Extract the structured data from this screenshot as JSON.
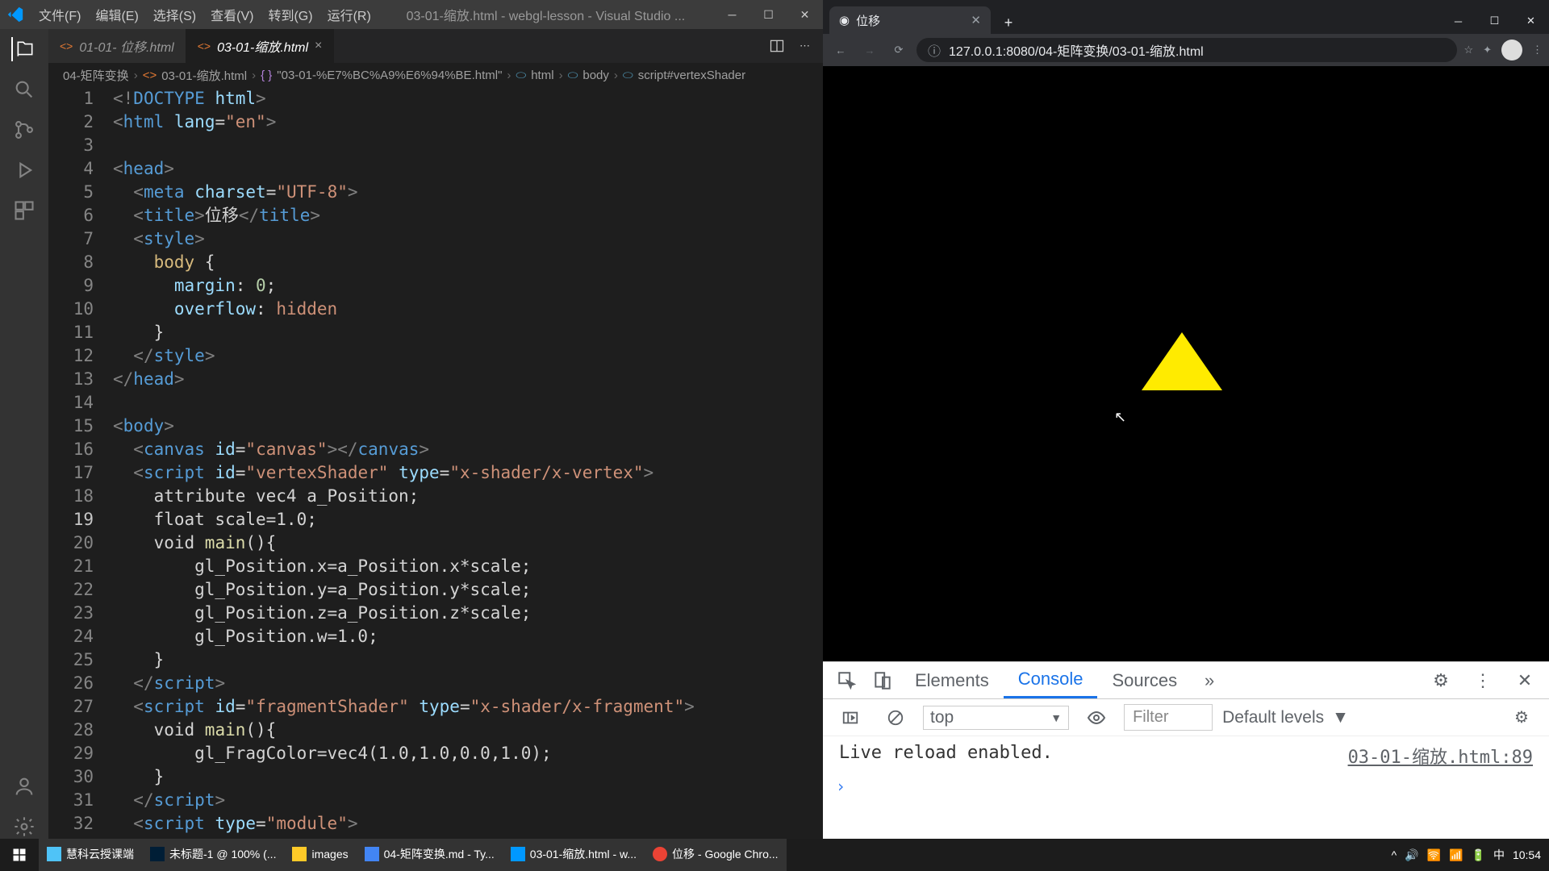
{
  "vscode": {
    "menus": [
      "文件(F)",
      "编辑(E)",
      "选择(S)",
      "查看(V)",
      "转到(G)",
      "运行(R)"
    ],
    "window_title": "03-01-缩放.html - webgl-lesson - Visual Studio ...",
    "tabs": [
      {
        "label": "01-01- 位移.html",
        "active": false
      },
      {
        "label": "03-01-缩放.html",
        "active": true
      }
    ],
    "breadcrumb": [
      "04-矩阵变换",
      "03-01-缩放.html",
      "{}",
      "\"03-01-%E7%BC%A9%E6%94%BE.html\"",
      "html",
      "body",
      "script#vertexShader"
    ],
    "code": {
      "lines": 32,
      "current_line": 19,
      "content_html": "<span class=\"c-pun\">&lt;!</span><span class=\"doctype\">DOCTYPE</span> <span class=\"c-attr\">html</span><span class=\"c-pun\">&gt;</span>\n<span class=\"c-pun\">&lt;</span><span class=\"c-tag\">html</span> <span class=\"c-attr\">lang</span>=<span class=\"c-str\">\"en\"</span><span class=\"c-pun\">&gt;</span>\n\n<span class=\"c-pun\">&lt;</span><span class=\"c-tag\">head</span><span class=\"c-pun\">&gt;</span>\n  <span class=\"c-pun\">&lt;</span><span class=\"c-tag\">meta</span> <span class=\"c-attr\">charset</span>=<span class=\"c-str\">\"UTF-8\"</span><span class=\"c-pun\">&gt;</span>\n  <span class=\"c-pun\">&lt;</span><span class=\"c-tag\">title</span><span class=\"c-pun\">&gt;</span>位移<span class=\"c-pun\">&lt;/</span><span class=\"c-tag\">title</span><span class=\"c-pun\">&gt;</span>\n  <span class=\"c-pun\">&lt;</span><span class=\"c-tag\">style</span><span class=\"c-pun\">&gt;</span>\n    <span class=\"c-sel\">body</span> {\n      <span class=\"c-prop\">margin</span>: <span class=\"c-num\">0</span>;\n      <span class=\"c-prop\">overflow</span>: <span class=\"c-val\">hidden</span>\n    }\n  <span class=\"c-pun\">&lt;/</span><span class=\"c-tag\">style</span><span class=\"c-pun\">&gt;</span>\n<span class=\"c-pun\">&lt;/</span><span class=\"c-tag\">head</span><span class=\"c-pun\">&gt;</span>\n\n<span class=\"c-pun\">&lt;</span><span class=\"c-tag\">body</span><span class=\"c-pun\">&gt;</span>\n  <span class=\"c-pun\">&lt;</span><span class=\"c-tag\">canvas</span> <span class=\"c-attr\">id</span>=<span class=\"c-str\">\"canvas\"</span><span class=\"c-pun\">&gt;&lt;/</span><span class=\"c-tag\">canvas</span><span class=\"c-pun\">&gt;</span>\n  <span class=\"c-pun\">&lt;</span><span class=\"c-tag\">script</span> <span class=\"c-attr\">id</span>=<span class=\"c-str\">\"vertexShader\"</span> <span class=\"c-attr\">type</span>=<span class=\"c-str\">\"x-shader/x-vertex\"</span><span class=\"c-pun\">&gt;</span>\n    attribute vec4 a_Position;\n    float scale=1.0;\n    void <span class=\"c-fn\">main</span>(){\n        gl_Position.x=a_Position.x*scale;\n        gl_Position.y=a_Position.y*scale;\n        gl_Position.z=a_Position.z*scale;\n        gl_Position.w=1.0;\n    }\n  <span class=\"c-pun\">&lt;/</span><span class=\"c-tag\">script</span><span class=\"c-pun\">&gt;</span>\n  <span class=\"c-pun\">&lt;</span><span class=\"c-tag\">script</span> <span class=\"c-attr\">id</span>=<span class=\"c-str\">\"fragmentShader\"</span> <span class=\"c-attr\">type</span>=<span class=\"c-str\">\"x-shader/x-fragment\"</span><span class=\"c-pun\">&gt;</span>\n    void <span class=\"c-fn\">main</span>(){\n        gl_FragColor=vec4(1.0,1.0,0.0,1.0);\n    }\n  <span class=\"c-pun\">&lt;/</span><span class=\"c-tag\">script</span><span class=\"c-pun\">&gt;</span>\n  <span class=\"c-pun\">&lt;</span><span class=\"c-tag\">script</span> <span class=\"c-attr\">type</span>=<span class=\"c-str\">\"module\"</span><span class=\"c-pun\">&gt;</span>"
    }
  },
  "chrome": {
    "tab_title": "位移",
    "url": "127.0.0.1:8080/04-矩阵变换/03-01-缩放.html",
    "devtools": {
      "tabs": [
        "Elements",
        "Console",
        "Sources"
      ],
      "active_tab": "Console",
      "context": "top",
      "filter_placeholder": "Filter",
      "levels": "Default levels",
      "log": "Live reload enabled.",
      "log_link": "03-01-缩放.html:89"
    }
  },
  "taskbar": {
    "items": [
      "慧科云授课端",
      "未标题-1 @ 100% (...",
      "images",
      "04-矩阵变换.md - Ty...",
      "03-01-缩放.html - w...",
      "位移 - Google Chro..."
    ],
    "lang": "中",
    "time": "10:54"
  }
}
